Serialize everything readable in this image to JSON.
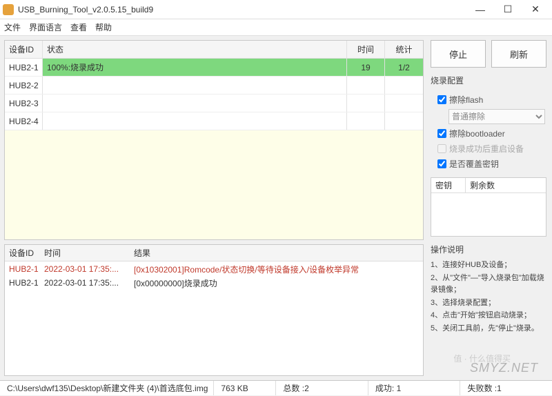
{
  "window": {
    "title": "USB_Burning_Tool_v2.0.5.15_build9"
  },
  "menu": [
    "文件",
    "界面语言",
    "查看",
    "帮助"
  ],
  "devtable": {
    "headers": {
      "id": "设备ID",
      "status": "状态",
      "time": "时间",
      "count": "统计"
    },
    "rows": [
      {
        "id": "HUB2-1",
        "status": "100%:烧录成功",
        "time": "19",
        "count": "1/2",
        "success": true
      },
      {
        "id": "HUB2-2",
        "status": "",
        "time": "",
        "count": ""
      },
      {
        "id": "HUB2-3",
        "status": "",
        "time": "",
        "count": ""
      },
      {
        "id": "HUB2-4",
        "status": "",
        "time": "",
        "count": ""
      }
    ]
  },
  "logtable": {
    "headers": {
      "id": "设备ID",
      "time": "时间",
      "result": "结果"
    },
    "rows": [
      {
        "id": "HUB2-1",
        "time": "2022-03-01 17:35:...",
        "result": "[0x10302001]Romcode/状态切换/等待设备接入/设备枚举异常",
        "err": true
      },
      {
        "id": "HUB2-1",
        "time": "2022-03-01 17:35:...",
        "result": "[0x00000000]烧录成功",
        "err": false
      }
    ]
  },
  "buttons": {
    "stop": "停止",
    "refresh": "刷新"
  },
  "config": {
    "title": "烧录配置",
    "erase_flash": "擦除flash",
    "erase_mode": "普通擦除",
    "erase_bootloader": "擦除bootloader",
    "reboot_after": "烧录成功后重启设备",
    "overwrite_key": "是否覆盖密钥"
  },
  "keytab": {
    "col1": "密钥",
    "col2": "剩余数"
  },
  "instructions": {
    "title": "操作说明",
    "items": [
      "1、连接好HUB及设备；",
      "2、从\"文件\"—\"导入烧录包\"加载烧录镜像；",
      "3、选择烧录配置；",
      "4、点击\"开始\"按钮启动烧录；",
      "5、关闭工具前，先\"停止\"烧录。"
    ]
  },
  "statusbar": {
    "path": "C:\\Users\\dwf135\\Desktop\\新建文件夹 (4)\\首选底包.img",
    "size": "763 KB",
    "total_label": "总数 :",
    "total": "2",
    "success_label": "成功:",
    "success": "1",
    "fail_label": "失败数 :",
    "fail": "1"
  },
  "watermark": "SMYZ.NET",
  "watermark2": "值 · 什么值得买"
}
